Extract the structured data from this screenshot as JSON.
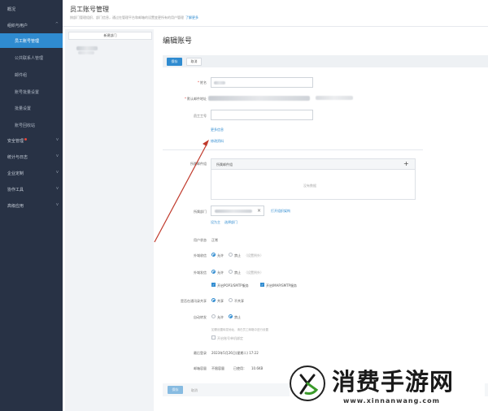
{
  "sidebar": {
    "items": [
      {
        "label": "概况"
      },
      {
        "label": "组织与用户"
      },
      {
        "label": "员工账号管理"
      },
      {
        "label": "公共联系人管理"
      },
      {
        "label": "邮件组"
      },
      {
        "label": "账号批量设置"
      },
      {
        "label": "批量设置"
      },
      {
        "label": "账号回收站"
      },
      {
        "label": "安全管理"
      },
      {
        "label": "统计与日志"
      },
      {
        "label": "企业定制"
      },
      {
        "label": "协作工具"
      },
      {
        "label": "高级应用"
      }
    ]
  },
  "header": {
    "title": "员工账号管理",
    "description": "按部门管理组织、部门信息，通过在管理平台和邮箱的设置变更所有的用户管理",
    "learn_more": "了解更多"
  },
  "dept_panel": {
    "new_dept_button": "新建部门"
  },
  "form": {
    "title": "编辑账号",
    "save_label": "保存",
    "cancel_label": "取消",
    "name_label": "姓名",
    "email_label": "默认邮件地址",
    "employee_id_label": "员工工号",
    "add_info_link": "更多信息",
    "edit_info_link": "修改资料",
    "mail_groups_label": "所属邮件组",
    "mail_groups_header": "所属邮件组",
    "mail_groups_add": "+",
    "mail_groups_empty": "没有数据",
    "dept_label": "所属部门",
    "dept_clear": "×",
    "dept_open_org": "打开组织架构",
    "dept_set_main": "设为主",
    "dept_add_sub": "选择部门",
    "status_label": "用户状态",
    "status_value": "正常",
    "outgoing_label": "外域收信",
    "outgoing_allow": "允许",
    "outgoing_forbid": "禁止",
    "outgoing_hint": "（设置例外）",
    "incoming_label": "外域发信",
    "incoming_allow": "允许",
    "incoming_forbid": "禁止",
    "incoming_hint": "（设置例外）",
    "pop_label": "开启POP3/SMTP服务",
    "imap_label": "开启IMAP/SMTP服务",
    "address_label": "是否在通讯录共享",
    "address_share": "共享",
    "address_noshare": "不共享",
    "forward_label": "自动转发",
    "forward_allow": "允许",
    "forward_forbid": "禁止",
    "forward_hint": "如需设置转发地址，请在员工邮箱中进行设置",
    "auto_reply_label": "开启账号单机绑定",
    "last_login_label": "最后登录",
    "last_login_value": "2023年5月26日(星期二) 17:22",
    "capacity_label": "邮箱容量",
    "capacity_value": "不限容量",
    "used_label": "已使用：",
    "used_value": "10.6KB",
    "bottom_save": "保存",
    "bottom_cancel": "取消"
  },
  "watermark": {
    "title": "消费手游网",
    "url": "www.xinnanwang.com"
  },
  "colors": {
    "sidebar_bg": "#283245",
    "accent": "#2f8bd0",
    "arrow": "#c0392b"
  }
}
